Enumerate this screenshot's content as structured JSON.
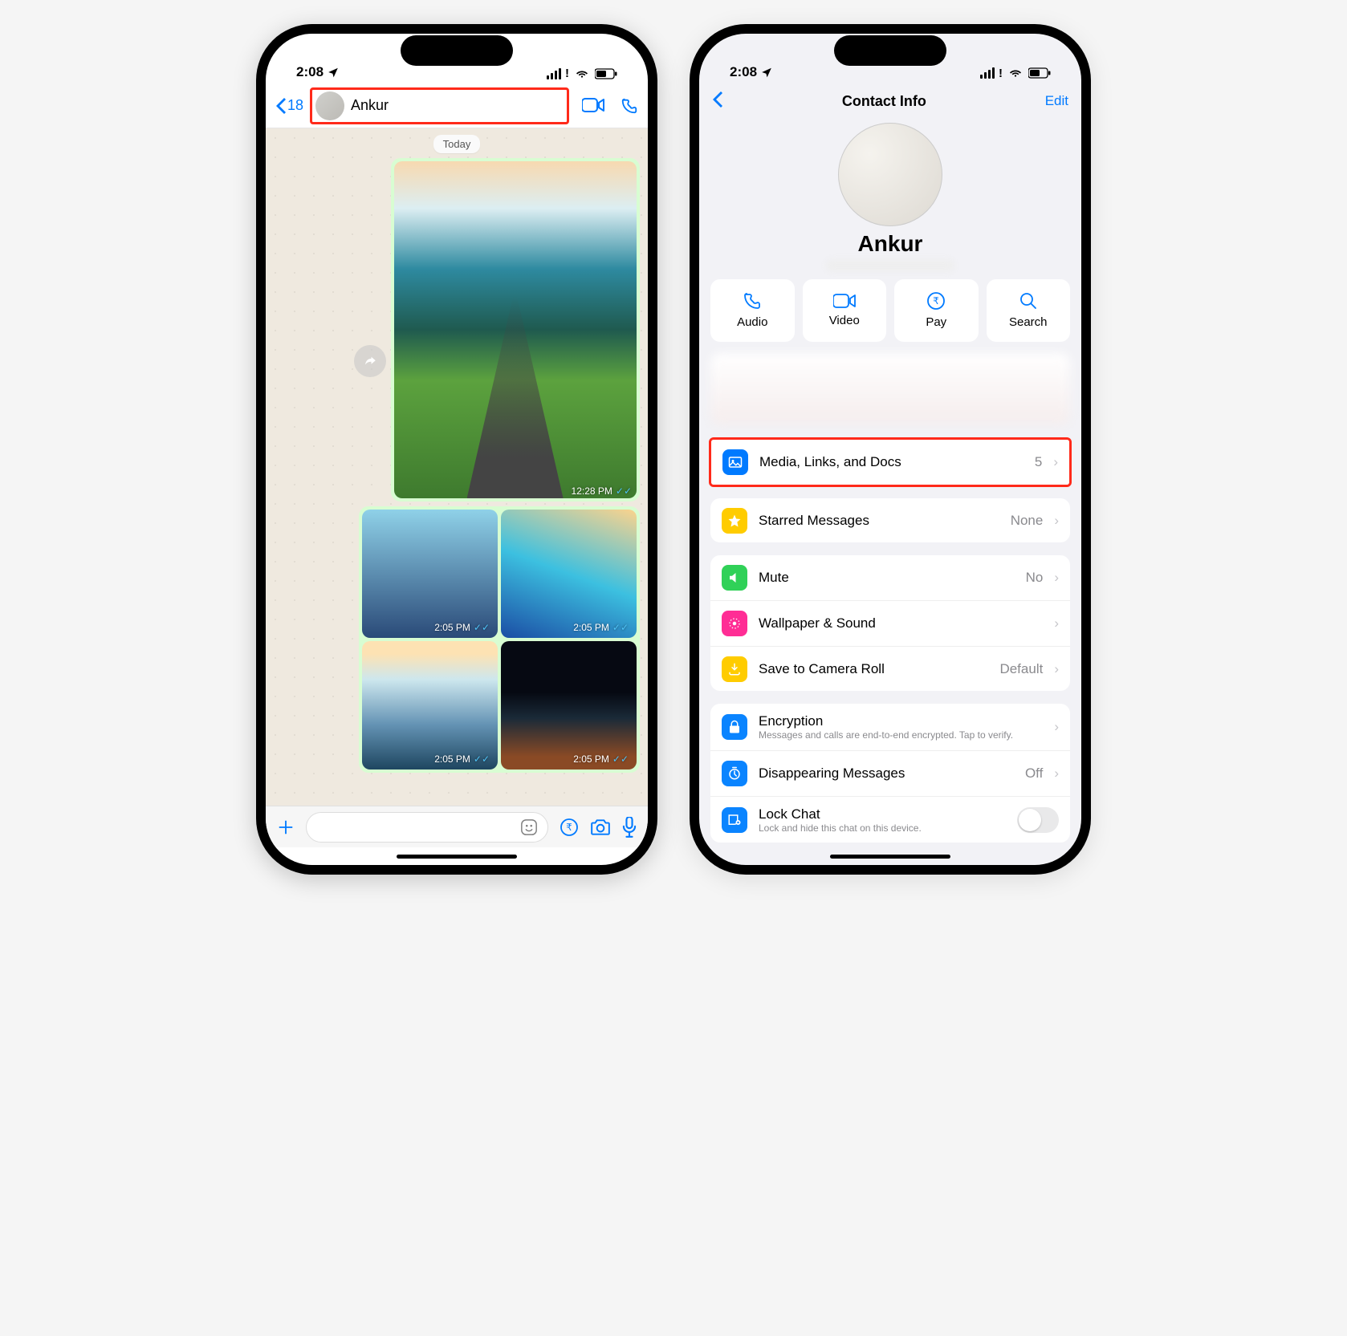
{
  "status": {
    "time": "2:08"
  },
  "chat": {
    "back_count": "18",
    "contact": "Ankur",
    "date_label": "Today",
    "messages": {
      "m1": {
        "time": "12:28 PM"
      },
      "grid": {
        "t1": "2:05 PM",
        "t2": "2:05 PM",
        "t3": "2:05 PM",
        "t4": "2:05 PM"
      }
    }
  },
  "contact_info": {
    "title": "Contact Info",
    "edit": "Edit",
    "name": "Ankur",
    "actions": {
      "audio": "Audio",
      "video": "Video",
      "pay": "Pay",
      "search": "Search"
    },
    "rows": {
      "media": {
        "label": "Media, Links, and Docs",
        "value": "5"
      },
      "starred": {
        "label": "Starred Messages",
        "value": "None"
      },
      "mute": {
        "label": "Mute",
        "value": "No"
      },
      "wallpaper": {
        "label": "Wallpaper & Sound"
      },
      "camroll": {
        "label": "Save to Camera Roll",
        "value": "Default"
      },
      "encryption": {
        "label": "Encryption",
        "sub": "Messages and calls are end-to-end encrypted. Tap to verify."
      },
      "disappear": {
        "label": "Disappearing Messages",
        "value": "Off"
      },
      "lock": {
        "label": "Lock Chat",
        "sub": "Lock and hide this chat on this device."
      }
    }
  },
  "colors": {
    "accent": "#007aff",
    "highlight": "#ff2a1a",
    "bubble": "#d8fdd2"
  }
}
